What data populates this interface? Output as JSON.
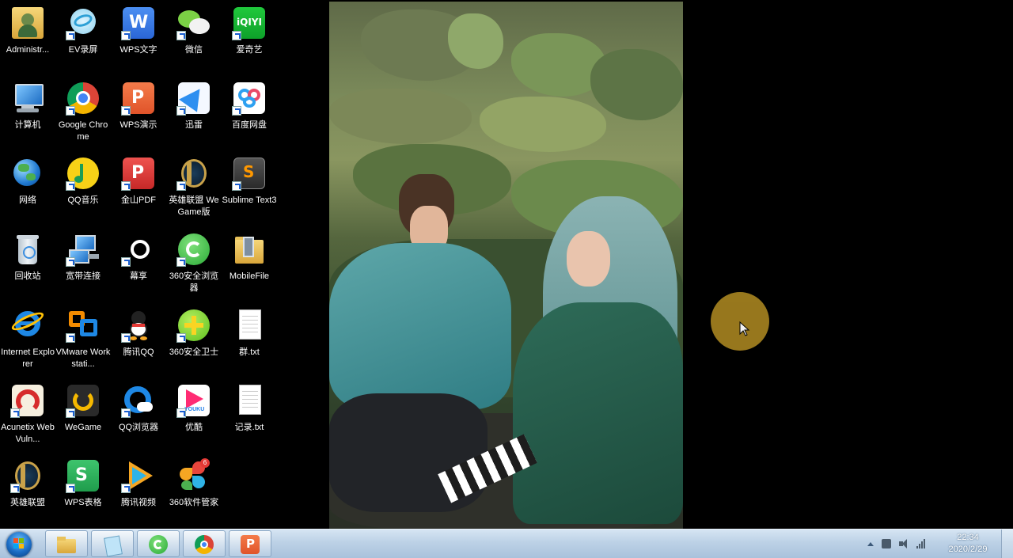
{
  "desktop_icons": [
    {
      "label": "Administr...",
      "icon": "user-folder-icon"
    },
    {
      "label": "EV录屏",
      "icon": "ev-recorder-icon"
    },
    {
      "label": "WPS文字",
      "icon": "wps-writer-icon"
    },
    {
      "label": "微信",
      "icon": "wechat-icon"
    },
    {
      "label": "爱奇艺",
      "icon": "iqiyi-icon"
    },
    {
      "label": "计算机",
      "icon": "computer-icon"
    },
    {
      "label": "Google Chrome",
      "icon": "chrome-icon"
    },
    {
      "label": "WPS演示",
      "icon": "wps-presentation-icon"
    },
    {
      "label": "迅雷",
      "icon": "xunlei-icon"
    },
    {
      "label": "百度网盘",
      "icon": "baidu-netdisk-icon"
    },
    {
      "label": "网络",
      "icon": "network-icon"
    },
    {
      "label": "QQ音乐",
      "icon": "qq-music-icon"
    },
    {
      "label": "金山PDF",
      "icon": "kingsoft-pdf-icon"
    },
    {
      "label": "英雄联盟 WeGame版",
      "icon": "lol-wegame-icon"
    },
    {
      "label": "Sublime Text3",
      "icon": "sublime-text-icon"
    },
    {
      "label": "回收站",
      "icon": "recycle-bin-icon"
    },
    {
      "label": "宽带连接",
      "icon": "broadband-icon"
    },
    {
      "label": "幕享",
      "icon": "muxiang-icon"
    },
    {
      "label": "360安全浏览器",
      "icon": "360-browser-icon"
    },
    {
      "label": "MobileFile",
      "icon": "folder-icon"
    },
    {
      "label": "Internet Explorer",
      "icon": "ie-icon"
    },
    {
      "label": "VMware Workstati...",
      "icon": "vmware-icon"
    },
    {
      "label": "腾讯QQ",
      "icon": "qq-icon"
    },
    {
      "label": "360安全卫士",
      "icon": "360-security-icon"
    },
    {
      "label": "群.txt",
      "icon": "text-file-icon"
    },
    {
      "label": "Acunetix Web Vuln...",
      "icon": "acunetix-icon"
    },
    {
      "label": "WeGame",
      "icon": "wegame-icon"
    },
    {
      "label": "QQ浏览器",
      "icon": "qq-browser-icon"
    },
    {
      "label": "优酷",
      "icon": "youku-icon"
    },
    {
      "label": "记录.txt",
      "icon": "text-file-icon"
    },
    {
      "label": "英雄联盟",
      "icon": "lol-icon"
    },
    {
      "label": "WPS表格",
      "icon": "wps-spreadsheet-icon"
    },
    {
      "label": "腾讯视频",
      "icon": "tencent-video-icon"
    },
    {
      "label": "360软件管家",
      "icon": "360-software-icon"
    }
  ],
  "taskbar": {
    "buttons": [
      "explorer-icon",
      "notepad-icon",
      "360-browser-icon",
      "chrome-icon",
      "wps-presentation-icon"
    ],
    "clock_time": "22:34",
    "clock_date": "2020/2/29"
  }
}
